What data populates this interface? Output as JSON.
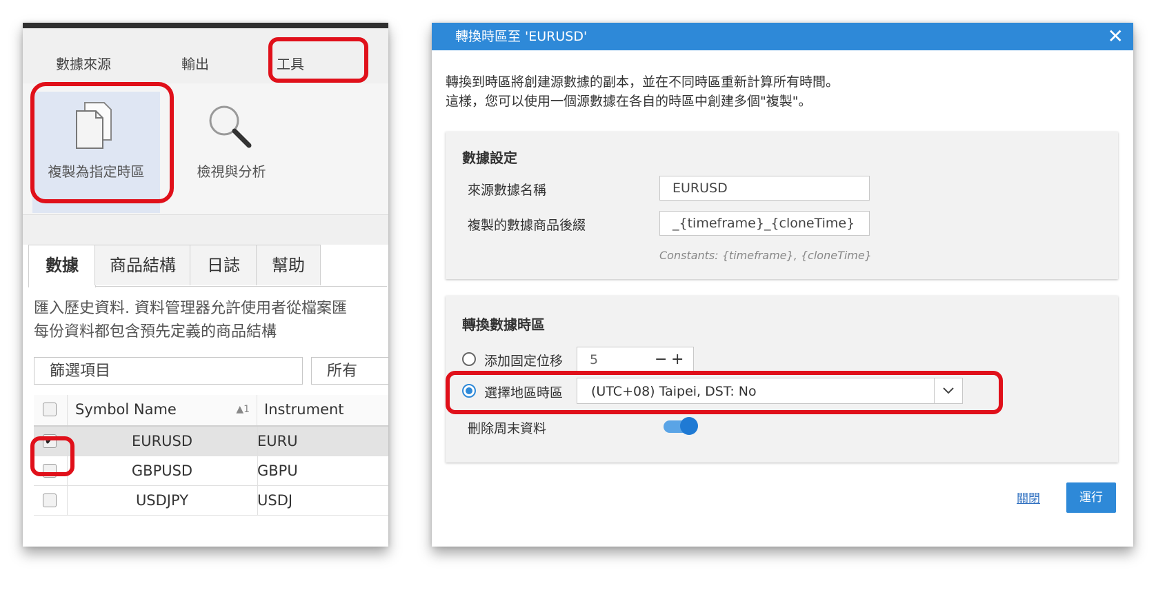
{
  "left_panel": {
    "menu_tabs": [
      "數據來源",
      "輸出",
      "工具"
    ],
    "ribbon": {
      "clone_button_label": "複製為指定時區",
      "view_button_label": "檢視與分析"
    },
    "subtabs": [
      "數據",
      "商品結構",
      "日誌",
      "幫助"
    ],
    "description_lines": [
      "匯入歷史資料. 資料管理器允許使用者從檔案匯",
      "每份資料都包含預先定義的商品結構"
    ],
    "filter_placeholder": "篩選項目",
    "filter_select_value": "所有",
    "grid": {
      "columns": [
        "Symbol Name",
        "Instrument"
      ],
      "sort_indicator": "▲1",
      "rows": [
        {
          "symbol": "EURUSD",
          "instrument": "EURU",
          "checked": true
        },
        {
          "symbol": "GBPUSD",
          "instrument": "GBPU",
          "checked": false
        },
        {
          "symbol": "USDJPY",
          "instrument": "USDJ",
          "checked": false
        }
      ],
      "check_mark": "✔"
    }
  },
  "dialog": {
    "title": "轉換時區至 'EURUSD'",
    "close_icon": "✕",
    "intro_lines": [
      "轉換到時區將創建源數據的副本，並在不同時區重新計算所有時間。",
      "這樣，您可以使用一個源數據在各自的時區中創建多個\"複製\"。"
    ],
    "data_settings": {
      "title": "數據設定",
      "source_label": "來源數據名稱",
      "source_value": "EURUSD",
      "suffix_label": "複製的數據商品後綴",
      "suffix_value": "_{timeframe}_{cloneTime}",
      "constants_hint": "Constants: {timeframe}, {cloneTime}"
    },
    "timezone": {
      "title": "轉換數據時區",
      "fixed_offset_label": "添加固定位移",
      "fixed_offset_value": "5",
      "stepper_minus": "−",
      "stepper_plus": "+",
      "region_label": "選擇地區時區",
      "region_value": "(UTC+08) Taipei, DST: No",
      "dropdown_arrow": "⌄",
      "remove_weekend_label": "刪除周末資料",
      "remove_weekend_on": true
    },
    "footer": {
      "close_label": "關閉",
      "run_label": "運行"
    }
  },
  "colors": {
    "accent": "#2e89d8",
    "highlight_red": "#e0101a"
  }
}
